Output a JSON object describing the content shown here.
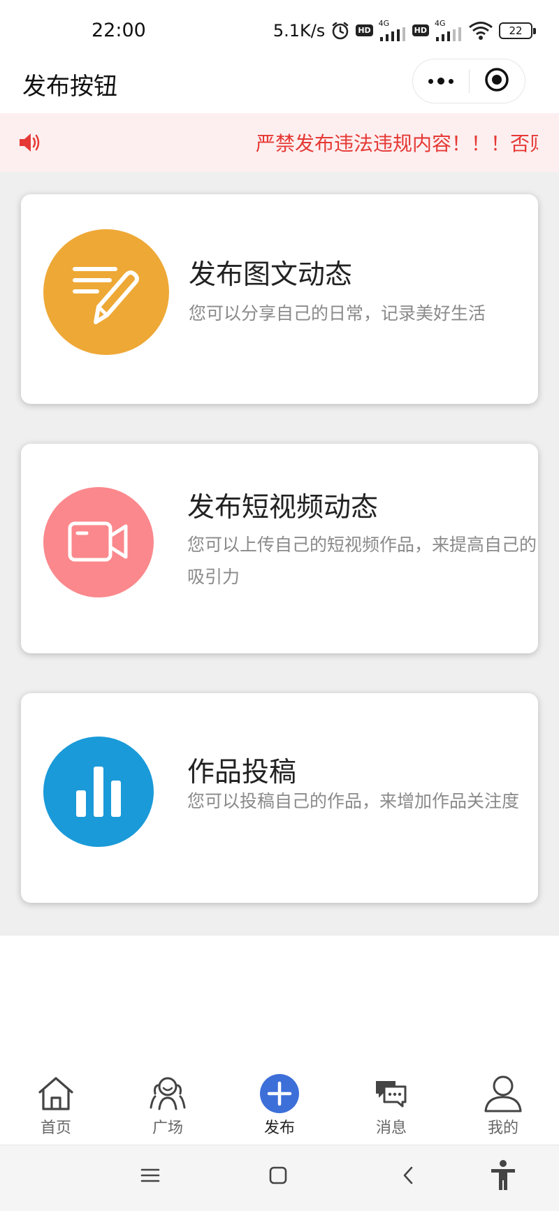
{
  "status_bar": {
    "time": "22:00",
    "network_speed": "5.1K/s",
    "hd1": "HD",
    "net1": "4G",
    "hd2": "HD",
    "net2": "4G",
    "battery": "22",
    "icons": [
      "alarm-icon",
      "signal-icon",
      "wifi-icon",
      "battery-icon"
    ]
  },
  "nav_bar": {
    "title": "发布按钮",
    "icons": [
      "more-dots-icon",
      "target-icon"
    ]
  },
  "notice": {
    "text": "严禁发布违法违规内容！！！否则",
    "color": "#e53935",
    "background": "#fdeff0",
    "icon": "speaker-icon"
  },
  "cards": [
    {
      "title": "发布图文动态",
      "desc": "您可以分享自己的日常，记录美好生活",
      "icon": "pencil-list-icon",
      "color": "#eea836"
    },
    {
      "title": "发布短视频动态",
      "desc": "您可以上传自己的短视频作品，来提高自己的吸引力",
      "icon": "video-camera-icon",
      "color": "#fb888c"
    },
    {
      "title": "作品投稿",
      "desc": "您可以投稿自己的作品，来增加作品关注度",
      "icon": "bar-chart-icon",
      "color": "#1a9ad8"
    }
  ],
  "tabs": [
    {
      "label": "首页",
      "icon": "home-icon"
    },
    {
      "label": "广场",
      "icon": "people-icon"
    },
    {
      "label": "发布",
      "icon": "plus-circle-icon",
      "active": true,
      "color": "#3d6fd9"
    },
    {
      "label": "消息",
      "icon": "chat-icon"
    },
    {
      "label": "我的",
      "icon": "user-icon"
    }
  ],
  "system_nav": [
    "menu-icon",
    "home-square-icon",
    "back-icon",
    "accessibility-icon"
  ]
}
